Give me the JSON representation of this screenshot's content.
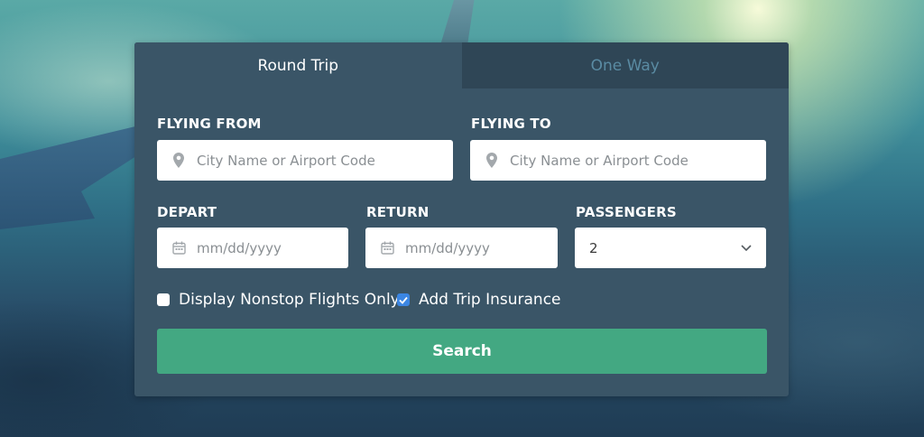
{
  "tabs": [
    {
      "label": "Round Trip",
      "active": true
    },
    {
      "label": "One Way",
      "active": false
    }
  ],
  "flying_from": {
    "label": "FLYING FROM",
    "placeholder": "City Name or Airport Code",
    "icon": "map-pin-icon"
  },
  "flying_to": {
    "label": "FLYING TO",
    "placeholder": "City Name or Airport Code",
    "icon": "map-pin-icon"
  },
  "depart": {
    "label": "DEPART",
    "placeholder": "mm/dd/yyyy",
    "icon": "calendar-icon"
  },
  "return_date": {
    "label": "RETURN",
    "placeholder": "mm/dd/yyyy",
    "icon": "calendar-icon"
  },
  "passengers": {
    "label": "PASSENGERS",
    "value": "2",
    "icon": "chevron-down-icon"
  },
  "options": [
    {
      "label": "Display Nonstop Flights Only",
      "checked": false
    },
    {
      "label": "Add Trip Insurance",
      "checked": true
    }
  ],
  "search_label": "Search",
  "colors": {
    "panel": "#3a5567",
    "tab_inactive": "#2f4656",
    "tab_inactive_text": "#5a8ba3",
    "accent": "#43a882",
    "checkbox_checked": "#3b86e3"
  }
}
